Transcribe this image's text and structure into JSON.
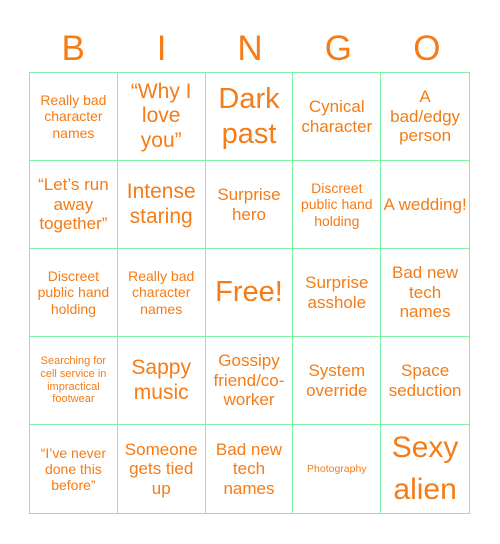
{
  "header": {
    "letters": [
      "B",
      "I",
      "N",
      "G",
      "O"
    ]
  },
  "colors": {
    "text": "#f57c16",
    "grid_line": "#7cf2a4",
    "background": "#ffffff"
  },
  "cells": [
    "Really bad character names",
    "“Why I love you”",
    "Dark past",
    "Cynical character",
    "A bad/edgy person",
    "“Let’s run away together”",
    "Intense staring",
    "Surprise hero",
    "Discreet public hand holding",
    "A wedding!",
    "Discreet public hand holding",
    "Really bad character names",
    "Free!",
    "Surprise asshole",
    "Bad new tech names",
    "Searching for cell service in impractical footwear",
    "Sappy music",
    "Gossipy friend/co-worker",
    "System override",
    "Space seduction",
    "“I’ve never done this before”",
    "Someone gets tied up",
    "Bad new tech names",
    "Photography",
    "Sexy alien"
  ]
}
